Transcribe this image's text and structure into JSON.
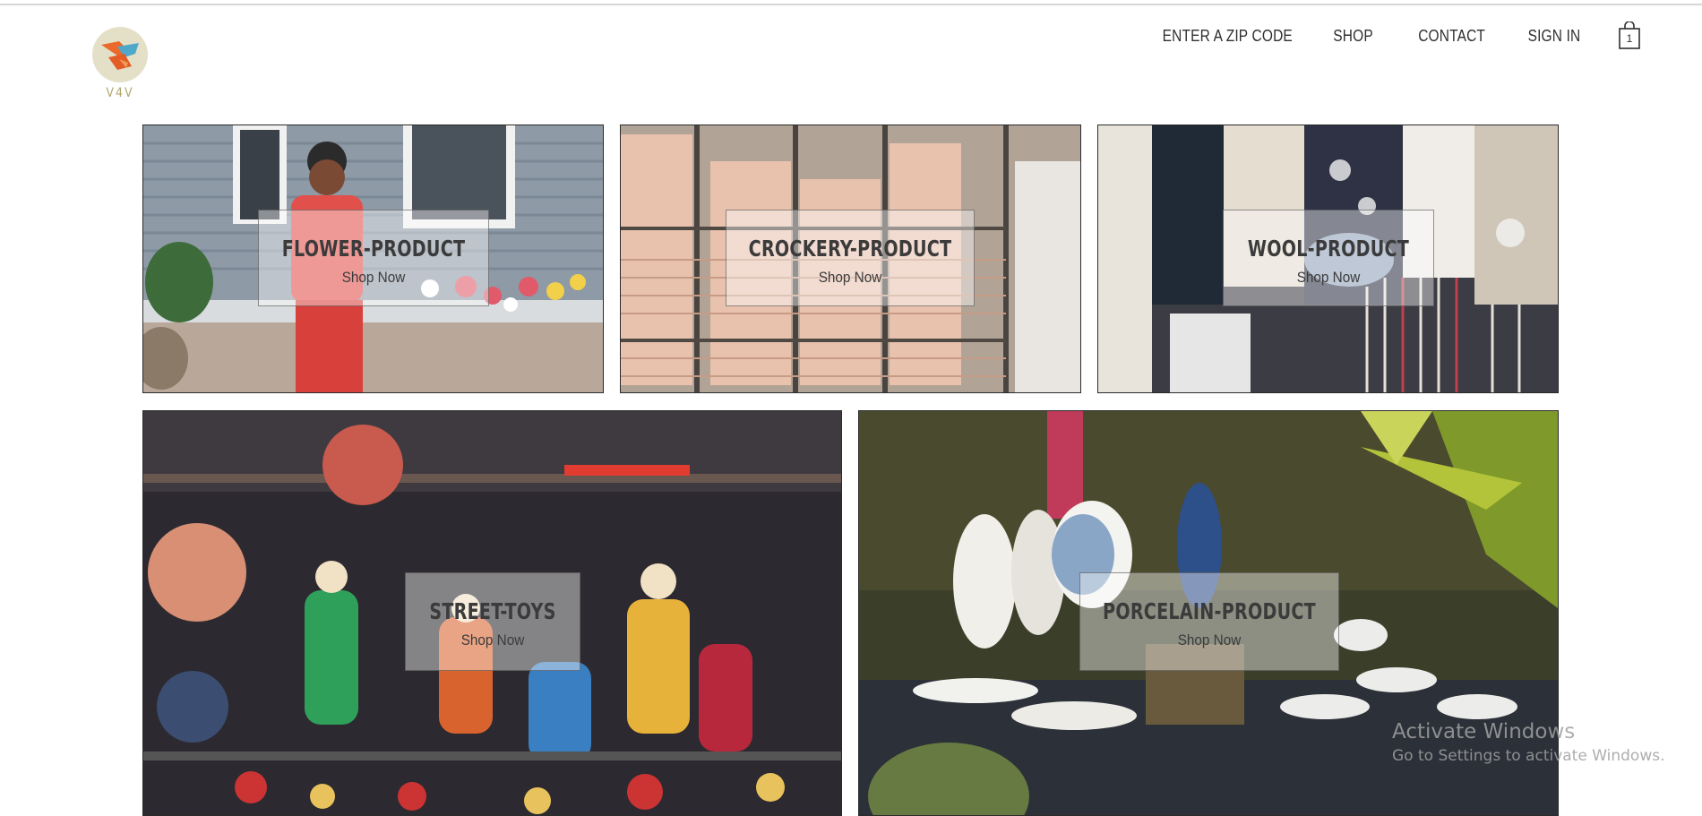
{
  "brand": {
    "logo_text": "V4V"
  },
  "nav": {
    "items": [
      {
        "label": "ENTER A ZIP CODE"
      },
      {
        "label": "SHOP"
      },
      {
        "label": "CONTACT"
      },
      {
        "label": "SIGN IN"
      }
    ],
    "cart_count": "1",
    "cart_icon": "shopping-bag-icon"
  },
  "tiles": [
    {
      "title": "FLOWER-PRODUCT",
      "cta": "Shop Now"
    },
    {
      "title": "CROCKERY-PRODUCT",
      "cta": "Shop Now"
    },
    {
      "title": "WOOL-PRODUCT",
      "cta": "Shop Now"
    },
    {
      "title": "STREET-TOYS",
      "cta": "Shop Now"
    },
    {
      "title": "PORCELAIN-PRODUCT",
      "cta": "Shop Now"
    }
  ],
  "watermark": {
    "line1": "Activate Windows",
    "line2": "Go to Settings to activate Windows."
  }
}
